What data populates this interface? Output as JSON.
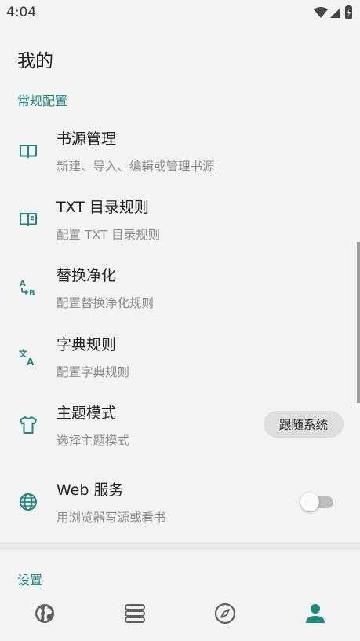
{
  "status_bar": {
    "time": "4:04"
  },
  "page_title": "我的",
  "sections": [
    {
      "title": "常规配置"
    },
    {
      "title": "设置"
    }
  ],
  "items": [
    {
      "title": "书源管理",
      "subtitle": "新建、导入、编辑或管理书源",
      "icon": "book-icon"
    },
    {
      "title": "TXT 目录规则",
      "subtitle": "配置 TXT 目录规则",
      "icon": "book-toc-icon"
    },
    {
      "title": "替换净化",
      "subtitle": "配置替换净化规则",
      "icon": "find-replace-icon"
    },
    {
      "title": "字典规则",
      "subtitle": "配置字典规则",
      "icon": "translate-icon"
    },
    {
      "title": "主题模式",
      "subtitle": "选择主题模式",
      "icon": "tshirt-icon",
      "value": "跟随系统"
    },
    {
      "title": "Web 服务",
      "subtitle": "用浏览器写源或看书",
      "icon": "globe-icon",
      "toggle_on": false
    }
  ],
  "bottom_nav": [
    {
      "icon": "discover-globe-icon",
      "active": false
    },
    {
      "icon": "bookshelf-icon",
      "active": false
    },
    {
      "icon": "compass-icon",
      "active": false
    },
    {
      "icon": "person-icon",
      "active": true
    }
  ],
  "colors": {
    "accent": "#1a8a7e",
    "icon_gray": "#5f5f5f",
    "background": "#f3f3f3"
  }
}
